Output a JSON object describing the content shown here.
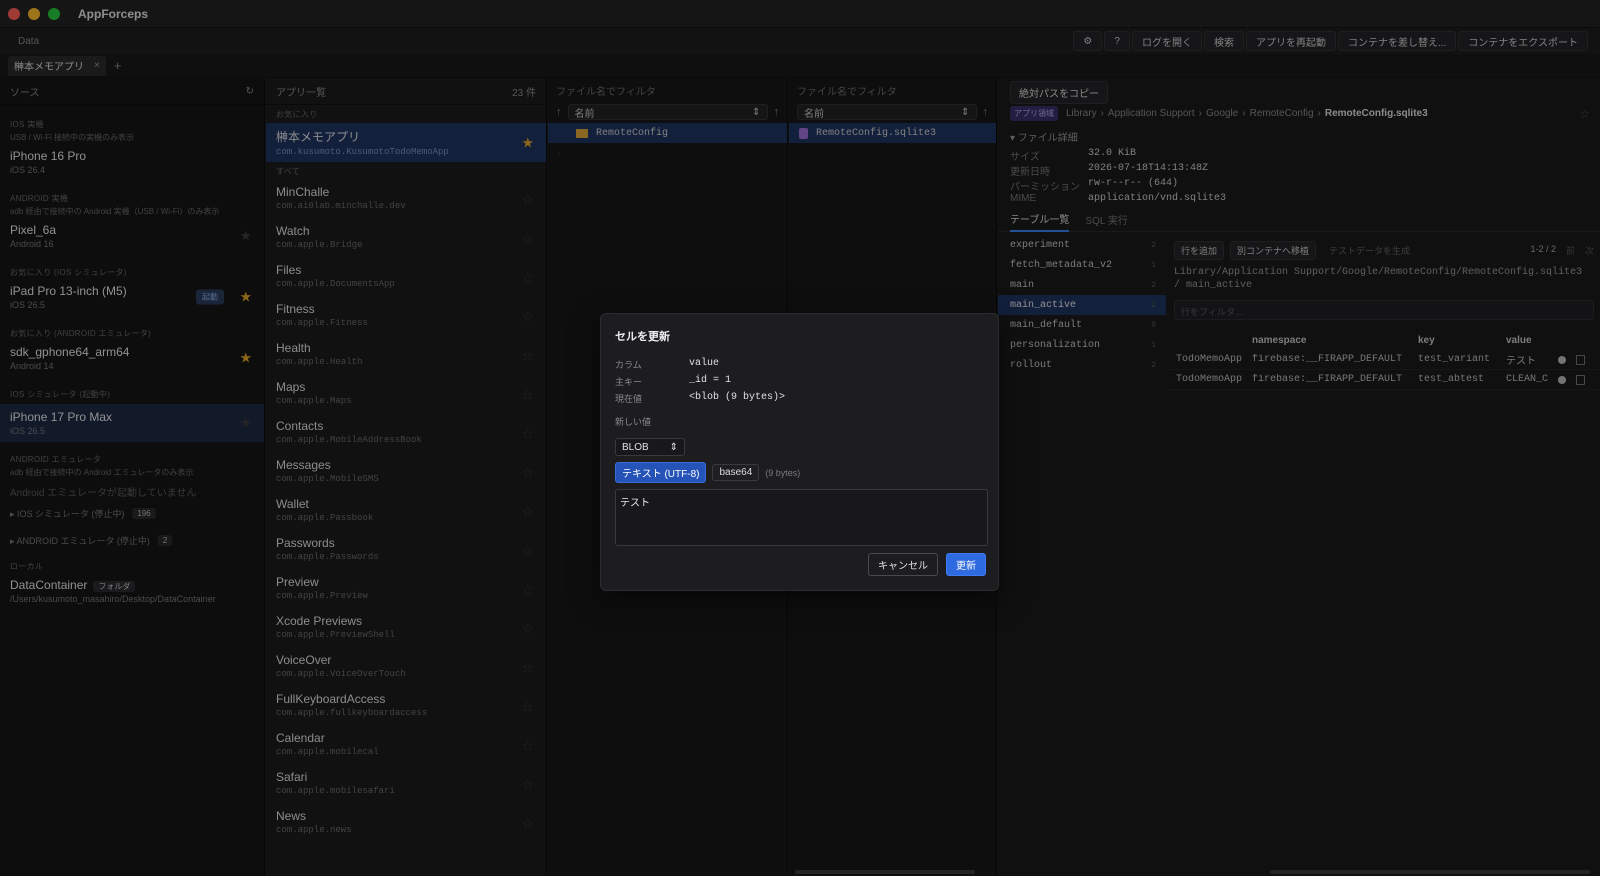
{
  "window": {
    "title": "AppForceps",
    "traffic_colors": [
      "#ff5f57",
      "#febc2e",
      "#28c840"
    ]
  },
  "menu": {
    "left": "Data"
  },
  "toolbar": {
    "settings_icon": "⚙",
    "help": "?",
    "open_log": "ログを開く",
    "search": "検索",
    "restart_app": "アプリを再起動",
    "replace_container": "コンテナを差し替え...",
    "export_container": "コンテナをエクスポート"
  },
  "tabs": {
    "active": "榊本メモアプリ",
    "close": "×",
    "add": "+"
  },
  "sources": {
    "header": "ソース",
    "refresh_icon": "↻",
    "sec_ios_real": "IOS 実機",
    "sec_ios_real_note": "USB / Wi-Fi 接続中の実機のみ表示",
    "iphone16": {
      "name": "iPhone 16 Pro",
      "sub": "iOS 26.4"
    },
    "sec_android_real": "ANDROID 実機",
    "sec_android_real_note": "adb 経由で接続中の Android 実機（USB / Wi-Fi）のみ表示",
    "pixel": {
      "name": "Pixel_6a",
      "sub": "Android 16"
    },
    "sec_fav_ios_sim": "お気に入り (IOS シミュレータ)",
    "ipad": {
      "name": "iPad Pro 13-inch (M5)",
      "sub": "iOS 26.5",
      "badge": "起動"
    },
    "sec_fav_android_emu": "お気に入り (ANDROID エミュレータ)",
    "sdk": {
      "name": "sdk_gphone64_arm64",
      "sub": "Android 14"
    },
    "sec_ios_sim_running": "IOS シミュレータ (起動中)",
    "iphone17": {
      "name": "iPhone 17 Pro Max",
      "sub": "iOS 26.5"
    },
    "sec_android_emu": "ANDROID エミュレータ",
    "sec_android_emu_note": "adb 経由で接続中の Android エミュレータのみ表示",
    "android_emu_empty": "Android エミュレータが起動していません",
    "ios_sim_stopped": "▸ IOS シミュレータ (停止中)",
    "ios_sim_stopped_count": "196",
    "android_emu_stopped": "▸ ANDROID エミュレータ (停止中)",
    "android_emu_stopped_count": "2",
    "sec_local": "ローカル",
    "datacontainer": {
      "name": "DataContainer",
      "chip": "フォルダ",
      "path": "/Users/kusumoto_masahiro/Desktop/DataContainer"
    }
  },
  "apps": {
    "header": "アプリ一覧",
    "count": "23 件",
    "sec_fav": "お気に入り",
    "fav": {
      "name": "榊本メモアプリ",
      "bid": "com.kusumoto.KusumotoTodoMemoApp"
    },
    "sec_all": "すべて",
    "list": [
      {
        "name": "MinChalle",
        "bid": "com.ai0lab.minchalle.dev"
      },
      {
        "name": "Watch",
        "bid": "com.apple.Bridge"
      },
      {
        "name": "Files",
        "bid": "com.apple.DocumentsApp"
      },
      {
        "name": "Fitness",
        "bid": "com.apple.Fitness"
      },
      {
        "name": "Health",
        "bid": "com.apple.Health"
      },
      {
        "name": "Maps",
        "bid": "com.apple.Maps"
      },
      {
        "name": "Contacts",
        "bid": "com.apple.MobileAddressBook"
      },
      {
        "name": "Messages",
        "bid": "com.apple.MobileSMS"
      },
      {
        "name": "Wallet",
        "bid": "com.apple.Passbook"
      },
      {
        "name": "Passwords",
        "bid": "com.apple.Passwords"
      },
      {
        "name": "Preview",
        "bid": "com.apple.Preview"
      },
      {
        "name": "Xcode Previews",
        "bid": "com.apple.PreviewShell"
      },
      {
        "name": "VoiceOver",
        "bid": "com.apple.VoiceOverTouch"
      },
      {
        "name": "FullKeyboardAccess",
        "bid": "com.apple.fullkeyboardaccess"
      },
      {
        "name": "Calendar",
        "bid": "com.apple.mobilecal"
      },
      {
        "name": "Safari",
        "bid": "com.apple.mobilesafari"
      },
      {
        "name": "News",
        "bid": "com.apple.news"
      }
    ]
  },
  "files1": {
    "filter_placeholder": "ファイル名でフィルタ",
    "sort_label": "名前",
    "rows": [
      {
        "name": "RemoteConfig"
      }
    ]
  },
  "files2": {
    "filter_placeholder": "ファイル名でフィルタ",
    "sort_label": "名前",
    "rows": [
      {
        "name": "RemoteConfig.sqlite3"
      }
    ]
  },
  "detail": {
    "copy_path": "絶対パスをコピー",
    "crumb_chip": "アプリ領域",
    "crumbs": [
      "Library",
      "Application Support",
      "Google",
      "RemoteConfig"
    ],
    "crumb_last": "RemoteConfig.sqlite3",
    "sep": "›",
    "file_details_title": "▾ ファイル詳細",
    "size_k": "サイズ",
    "size_v": "32.0 KiB",
    "mtime_k": "更新日時",
    "mtime_v": "2026-07-18T14:13:48Z",
    "perm_k": "パーミッション",
    "perm_v": "rw-r--r-- (644)",
    "mime_k": "MIME",
    "mime_v": "application/vnd.sqlite3",
    "tab_tables": "テーブル一覧",
    "tab_sql": "SQL 実行",
    "tables": [
      {
        "name": "experiment",
        "cnt": "2"
      },
      {
        "name": "fetch_metadata_v2",
        "cnt": "1"
      },
      {
        "name": "main",
        "cnt": "2"
      },
      {
        "name": "main_active",
        "cnt": "2"
      },
      {
        "name": "main_default",
        "cnt": "0"
      },
      {
        "name": "personalization",
        "cnt": "1"
      },
      {
        "name": "rollout",
        "cnt": "2"
      }
    ],
    "add_row": "行を追加",
    "move_container": "別コンテナへ移植",
    "gen_test": "テストデータを生成",
    "pager": "1-2 / 2",
    "prev": "前",
    "next": "次",
    "table_path": "Library/Application Support/Google/RemoteConfig/RemoteConfig.sqlite3 / main_active",
    "row_filter_placeholder": "行をフィルタ...",
    "col_ns": "namespace",
    "col_key": "key",
    "col_value": "value",
    "rows": [
      {
        "app": "TodoMemoApp",
        "ns": "firebase:__FIRAPP_DEFAULT",
        "key": "test_variant",
        "value": "テスト"
      },
      {
        "app": "TodoMemoApp",
        "ns": "firebase:__FIRAPP_DEFAULT",
        "key": "test_abtest",
        "value": "CLEAN_C"
      }
    ]
  },
  "modal": {
    "title": "セルを更新",
    "column_k": "カラム",
    "column_v": "value",
    "pk_k": "主キー",
    "pk_v": "_id = 1",
    "current_k": "現在値",
    "current_v": "<blob (9 bytes)>",
    "new_value": "新しい値",
    "type_value": "BLOB",
    "enc_text": "テキスト (UTF-8)",
    "enc_b64": "base64",
    "bytes_note": "(9 bytes)",
    "textarea_value": "テスト",
    "cancel": "キャンセル",
    "submit": "更新"
  }
}
